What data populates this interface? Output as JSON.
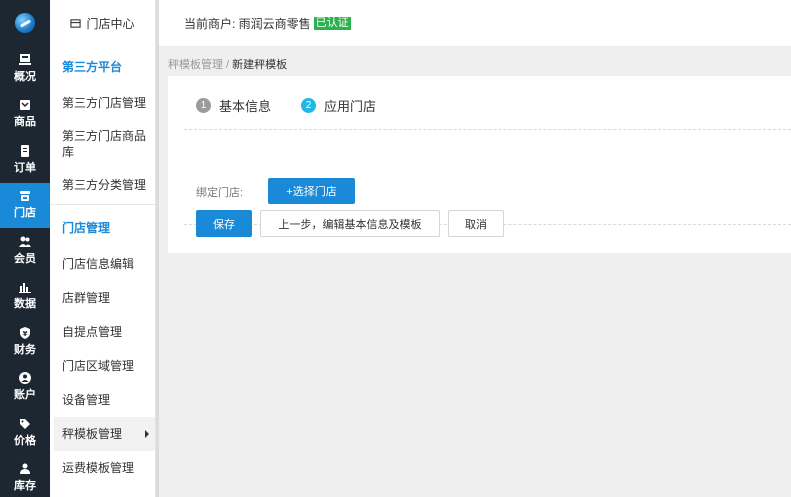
{
  "nav": {
    "items": [
      {
        "label": "概况",
        "icon": "overview-icon"
      },
      {
        "label": "商品",
        "icon": "goods-icon"
      },
      {
        "label": "订单",
        "icon": "order-icon"
      },
      {
        "label": "门店",
        "icon": "store-icon"
      },
      {
        "label": "会员",
        "icon": "member-icon"
      },
      {
        "label": "数据",
        "icon": "chart-icon"
      },
      {
        "label": "财务",
        "icon": "finance-icon"
      },
      {
        "label": "账户",
        "icon": "account-icon"
      },
      {
        "label": "价格",
        "icon": "price-tag-icon"
      },
      {
        "label": "库存",
        "icon": "stock-icon"
      }
    ]
  },
  "sidebar": {
    "header": "门店中心",
    "groups": [
      {
        "title": "第三方平台",
        "items": [
          "第三方门店管理",
          "第三方门店商品库",
          "第三方分类管理"
        ]
      },
      {
        "title": "门店管理",
        "items": [
          "门店信息编辑",
          "店群管理",
          "自提点管理",
          "门店区域管理",
          "设备管理",
          "秤模板管理",
          "运费模板管理"
        ]
      }
    ]
  },
  "topbar": {
    "merchant_label": "当前商户: 雨润云商零售",
    "verified_badge": "已认证"
  },
  "breadcrumb": {
    "parent": "秤模板管理",
    "separator": " / ",
    "current": "新建秤模板"
  },
  "steps": [
    {
      "num": "1",
      "label": "基本信息",
      "state": "done"
    },
    {
      "num": "2",
      "label": "应用门店",
      "state": "current"
    }
  ],
  "form": {
    "bind_store_label": "绑定门店:",
    "select_store_button": "+选择门店"
  },
  "actions": {
    "save": "保存",
    "prev": "上一步，编辑基本信息及模板",
    "cancel": "取消"
  },
  "colors": {
    "primary": "#1a8ad8",
    "nav_bg": "#1d2731",
    "badge": "#2bb24c",
    "step_current": "#21b8e8"
  }
}
